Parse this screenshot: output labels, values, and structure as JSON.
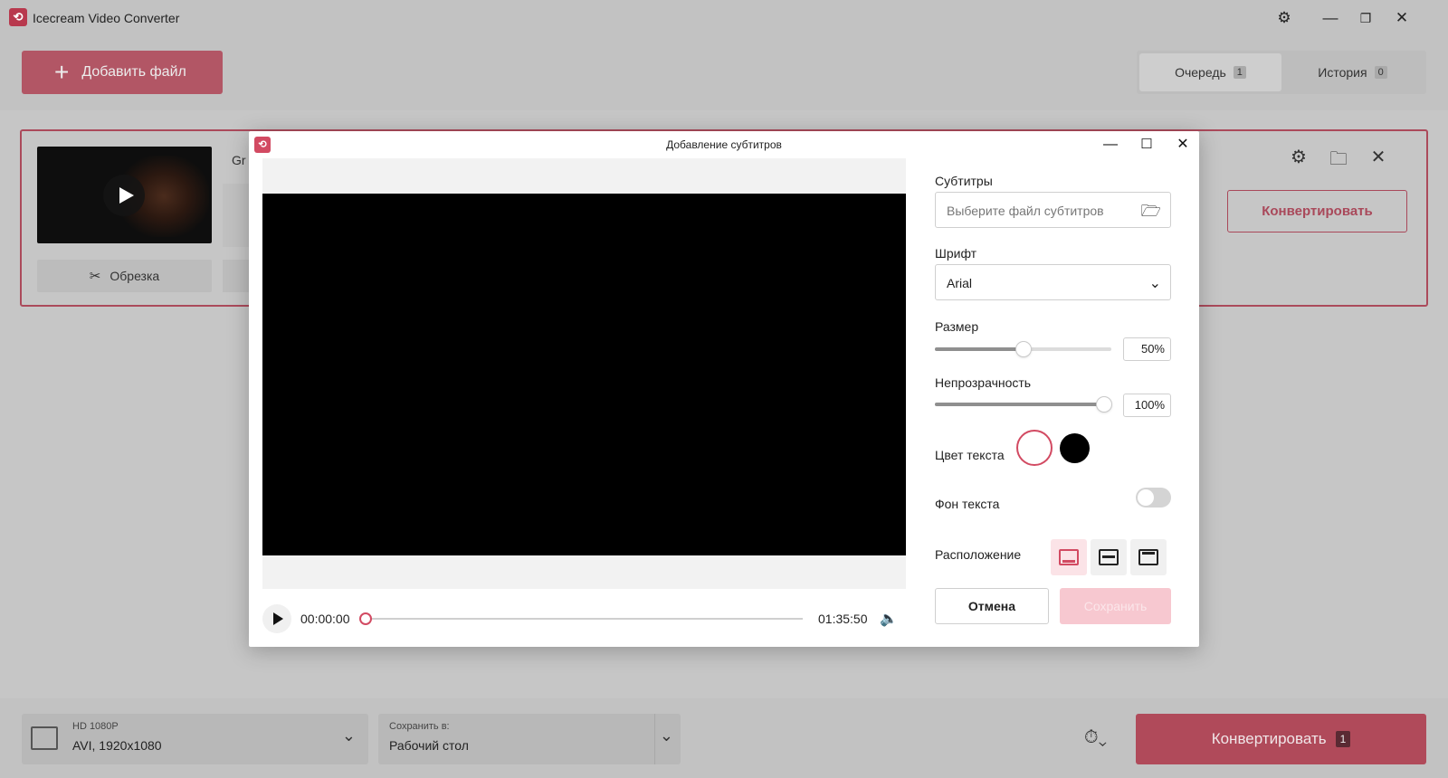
{
  "app": {
    "title": "Icecream Video Converter",
    "logo_glyph": "⟲"
  },
  "toolbar": {
    "add_file_label": "Добавить файл"
  },
  "tabs": [
    {
      "label": "Очередь",
      "count": "1",
      "active": true
    },
    {
      "label": "История",
      "count": "0",
      "active": false
    }
  ],
  "file_item": {
    "name_partial": "Gr",
    "cut_label": "Обрезка",
    "convert_label": "Конвертировать"
  },
  "bottom": {
    "format_line1": "HD 1080P",
    "format_line2": "AVI, 1920x1080",
    "save_to_label": "Сохранить в:",
    "save_to_value": "Рабочий стол",
    "convert_label": "Конвертировать",
    "convert_count": "1"
  },
  "dialog": {
    "title": "Добавление субтитров",
    "subtitles_label": "Субтитры",
    "subtitles_placeholder": "Выберите файл субтитров",
    "font_label": "Шрифт",
    "font_value": "Arial",
    "size_label": "Размер",
    "size_value": "50%",
    "size_percent": 50,
    "opacity_label": "Непрозрачность",
    "opacity_value": "100%",
    "opacity_percent": 100,
    "text_color_label": "Цвет текста",
    "text_colors": [
      "#ffffff",
      "#000000"
    ],
    "text_bg_label": "Фон текста",
    "text_bg_enabled": false,
    "position_label": "Расположение",
    "position_selected": "bottom",
    "cancel_label": "Отмена",
    "save_label": "Сохранить",
    "player": {
      "current_time": "00:00:00",
      "duration": "01:35:50",
      "progress": 0
    }
  },
  "colors": {
    "accent": "#d24a62",
    "accent_dim": "#b04a5a"
  }
}
